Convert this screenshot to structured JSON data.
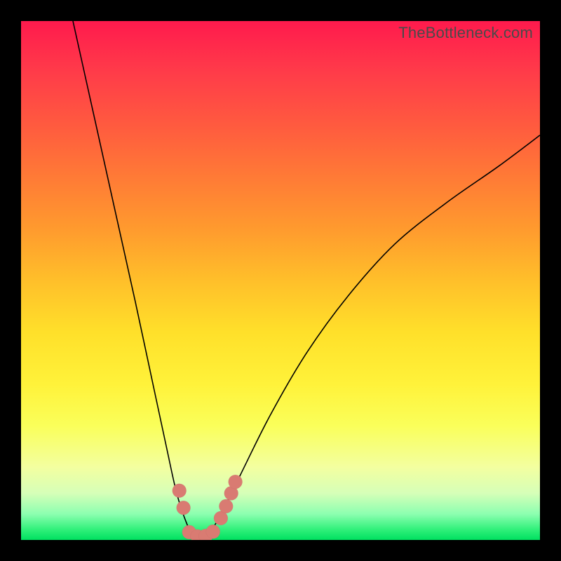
{
  "watermark": "TheBottleneck.com",
  "chart_data": {
    "type": "line",
    "title": "",
    "xlabel": "",
    "ylabel": "",
    "xlim": [
      0,
      100
    ],
    "ylim": [
      0,
      100
    ],
    "grid": false,
    "series": [
      {
        "name": "bottleneck-curve",
        "x": [
          10,
          14,
          18,
          22,
          25,
          28,
          30,
          32,
          33.5,
          35.5,
          38,
          42,
          48,
          55,
          63,
          72,
          82,
          92,
          100
        ],
        "y": [
          100,
          82,
          64,
          46,
          32,
          18,
          9,
          3,
          0.5,
          0.5,
          4,
          12,
          24,
          36,
          47,
          57,
          65,
          72,
          78
        ]
      }
    ],
    "markers": [
      {
        "name": "left-bead-1",
        "x": 30.5,
        "y": 9.5
      },
      {
        "name": "left-bead-2",
        "x": 31.3,
        "y": 6.2
      },
      {
        "name": "bottom-bead-1",
        "x": 32.4,
        "y": 1.5
      },
      {
        "name": "bottom-bead-2",
        "x": 34.0,
        "y": 0.7
      },
      {
        "name": "bottom-bead-3",
        "x": 35.6,
        "y": 0.8
      },
      {
        "name": "bottom-bead-4",
        "x": 37.0,
        "y": 1.6
      },
      {
        "name": "right-bead-1",
        "x": 38.5,
        "y": 4.2
      },
      {
        "name": "right-bead-2",
        "x": 39.5,
        "y": 6.5
      },
      {
        "name": "right-bead-3",
        "x": 40.5,
        "y": 9.0
      },
      {
        "name": "right-bead-4",
        "x": 41.3,
        "y": 11.2
      }
    ],
    "marker_radius_pct": 1.35,
    "background_gradient": {
      "top": "#ff1a4d",
      "mid": "#fff23a",
      "bottom": "#00e060"
    }
  }
}
